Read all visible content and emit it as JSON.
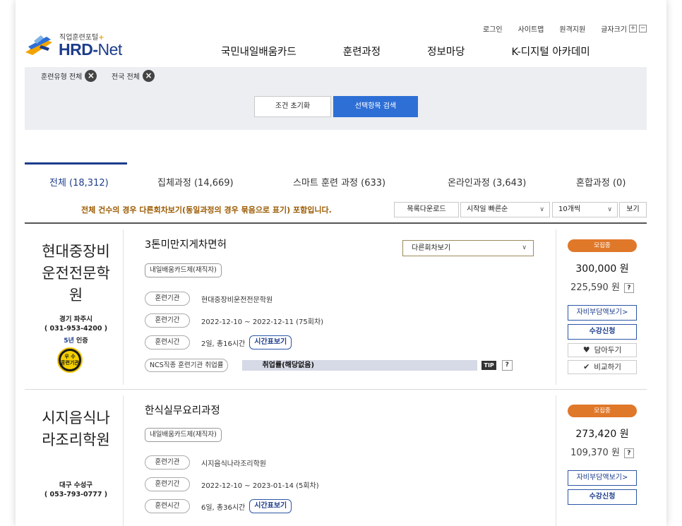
{
  "topnav": {
    "login": "로그인",
    "sitemap": "사이트맵",
    "remote": "원격지원",
    "fontsize": "글자크기",
    "plus": "+",
    "minus": "−"
  },
  "logo": {
    "sub": "직업훈련포털",
    "sub_plus": "+",
    "main": "HRD-",
    "net": "Net"
  },
  "mainnav": [
    "국민내일배움카드",
    "훈련과정",
    "정보마당",
    "K-디지털 아카데미"
  ],
  "filter": {
    "chips": [
      "훈련유형 전체",
      "전국 전체"
    ],
    "reset_label": "조건 초기화",
    "search_label": "선택항목 검색"
  },
  "tabs": [
    "전체 (18,312)",
    "집체과정 (14,669)",
    "스마트 훈련 과정 (633)",
    "온라인과정 (3,643)",
    "혼합과정 (0)"
  ],
  "notice": "전체 건수의 경우 다른회차보기(동일과정의 경우 묶음으로 표기) 포함입니다.",
  "toolbar": {
    "download": "목록다운로드",
    "sort": "시작일 빠른순",
    "per_page": "10개씩",
    "view": "보기"
  },
  "courses": [
    {
      "inst_lines": [
        "현대중장비",
        "운전전문학",
        "원"
      ],
      "loc": "경기 파주시",
      "phone": "( 031-953-4200 )",
      "cert_five": "5년",
      "cert_text": " 인증",
      "seal_top": "우 수",
      "seal_bottom": "훈련기관",
      "title": "3톤미만지게차면허",
      "tag": "내일배움카드제(재직자)",
      "dropdown": "다른회차보기",
      "org_label": "훈련기관",
      "org_value": "현대중장비운전전문학원",
      "period_label": "훈련기간",
      "period_value": "2022-12-10 ~ 2022-12-11 (75회차)",
      "time_label": "훈련시간",
      "time_value": "2일, 총16시간",
      "timetable_btn": "시간표보기",
      "ncs_label": "NCS직종 훈련기관 취업률",
      "employ": "취업률(해당없음)",
      "tip": "TIP",
      "q": "?",
      "status": "모집중",
      "price": "300,000 원",
      "price_self": "225,590 원",
      "self_btn": "자비부담액보기>",
      "apply_btn": "수강신청",
      "wish_btn": "담아두기",
      "compare_btn": "비교하기"
    },
    {
      "inst_lines": [
        "시지음식나",
        "라조리학원"
      ],
      "loc": "대구 수성구",
      "phone": "( 053-793-0777 )",
      "title": "한식실무요리과정",
      "tag": "내일배움카드제(재직자)",
      "org_label": "훈련기관",
      "org_value": "시지음식나라조리학원",
      "period_label": "훈련기간",
      "period_value": "2022-12-10 ~ 2023-01-14 (5회차)",
      "time_label": "훈련시간",
      "time_value": "6일, 총36시간",
      "timetable_btn": "시간표보기",
      "status": "모집중",
      "price": "273,420 원",
      "price_self": "109,370 원",
      "q": "?",
      "self_btn": "자비부담액보기>",
      "apply_btn": "수강신청"
    }
  ]
}
